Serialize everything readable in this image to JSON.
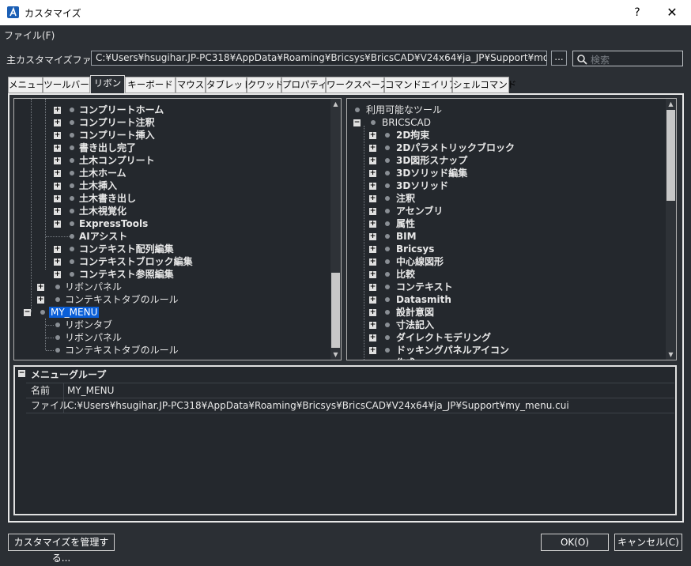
{
  "window": {
    "title": "カスタマイズ",
    "help": "?",
    "close": "✕"
  },
  "menu": {
    "file": "ファイル(F)"
  },
  "main_file": {
    "label": "主カスタマイズファイル:",
    "path": "C:¥Users¥hsugihar.JP-PC318¥AppData¥Roaming¥Bricsys¥BricsCAD¥V24x64¥ja_JP¥Support¥modern.cui",
    "browse": "..."
  },
  "search": {
    "placeholder": "検索"
  },
  "tabs": [
    {
      "label": "メニュー"
    },
    {
      "label": "ツールバー"
    },
    {
      "label": "リボン",
      "active": true
    },
    {
      "label": "キーボード"
    },
    {
      "label": "マウス"
    },
    {
      "label": "タブレット"
    },
    {
      "label": "クワッド"
    },
    {
      "label": "プロパティ"
    },
    {
      "label": "ワークスペース"
    },
    {
      "label": "コマンドエイリアス"
    },
    {
      "label": "シェルコマンド"
    }
  ],
  "left_tree": [
    {
      "label": "コンプリートホーム",
      "bold": true,
      "expand": "+"
    },
    {
      "label": "コンプリート注釈",
      "bold": true,
      "expand": "+"
    },
    {
      "label": "コンプリート挿入",
      "bold": true,
      "expand": "+"
    },
    {
      "label": "書き出し完了",
      "bold": true,
      "expand": "+"
    },
    {
      "label": "土木コンプリート",
      "bold": true,
      "expand": "+"
    },
    {
      "label": "土木ホーム",
      "bold": true,
      "expand": "+"
    },
    {
      "label": "土木挿入",
      "bold": true,
      "expand": "+"
    },
    {
      "label": "土木書き出し",
      "bold": true,
      "expand": "+"
    },
    {
      "label": "土木視覚化",
      "bold": true,
      "expand": "+"
    },
    {
      "label": "ExpressTools",
      "bold": true,
      "expand": "+"
    },
    {
      "label": "AIアシスト",
      "bold": true,
      "expand": ""
    },
    {
      "label": "コンテキスト配列編集",
      "bold": true,
      "expand": "+"
    },
    {
      "label": "コンテキストブロック編集",
      "bold": true,
      "expand": "+"
    },
    {
      "label": "コンテキスト参照編集",
      "bold": true,
      "expand": "+"
    },
    {
      "label": "リボンパネル",
      "bold": false,
      "expand": "+"
    },
    {
      "label": "コンテキストタブのルール",
      "bold": false,
      "expand": "+"
    },
    {
      "label": "MY_MENU",
      "bold": false,
      "expand": "−",
      "selected": true
    },
    {
      "label": "リボンタブ",
      "bold": false,
      "expand": ""
    },
    {
      "label": "リボンパネル",
      "bold": false,
      "expand": ""
    },
    {
      "label": "コンテキストタブのルール",
      "bold": false,
      "expand": ""
    }
  ],
  "right_tree": [
    {
      "label": "利用可能なツール",
      "bold": false,
      "expand": ""
    },
    {
      "label": "BRICSCAD",
      "bold": false,
      "expand": "−"
    },
    {
      "label": "2D拘束",
      "bold": true,
      "expand": "+"
    },
    {
      "label": "2Dパラメトリックブロック",
      "bold": true,
      "expand": "+"
    },
    {
      "label": "3D図形スナップ",
      "bold": true,
      "expand": "+"
    },
    {
      "label": "3Dソリッド編集",
      "bold": true,
      "expand": "+"
    },
    {
      "label": "3Dソリッド",
      "bold": true,
      "expand": "+"
    },
    {
      "label": "注釈",
      "bold": true,
      "expand": "+"
    },
    {
      "label": "アセンブリ",
      "bold": true,
      "expand": "+"
    },
    {
      "label": "属性",
      "bold": true,
      "expand": "+"
    },
    {
      "label": "BIM",
      "bold": true,
      "expand": "+"
    },
    {
      "label": "Bricsys",
      "bold": true,
      "expand": "+"
    },
    {
      "label": "中心線図形",
      "bold": true,
      "expand": "+"
    },
    {
      "label": "比較",
      "bold": true,
      "expand": "+"
    },
    {
      "label": "コンテキスト",
      "bold": true,
      "expand": "+"
    },
    {
      "label": "Datasmith",
      "bold": true,
      "expand": "+"
    },
    {
      "label": "設計意図",
      "bold": true,
      "expand": "+"
    },
    {
      "label": "寸法記入",
      "bold": true,
      "expand": "+"
    },
    {
      "label": "ダイレクトモデリング",
      "bold": true,
      "expand": "+"
    },
    {
      "label": "ドッキングパネルアイコン",
      "bold": true,
      "expand": "+"
    },
    {
      "label": "作成",
      "bold": true,
      "expand": "+"
    }
  ],
  "props": {
    "header": "メニューグループ",
    "rows": [
      {
        "key": "名前",
        "value": "MY_MENU"
      },
      {
        "key": "ファイル",
        "value": "C:¥Users¥hsugihar.JP-PC318¥AppData¥Roaming¥Bricsys¥BricsCAD¥V24x64¥ja_JP¥Support¥my_menu.cui"
      }
    ]
  },
  "buttons": {
    "manage": "カスタマイズを管理する...",
    "ok": "OK(O)",
    "cancel": "キャンセル(C)"
  }
}
